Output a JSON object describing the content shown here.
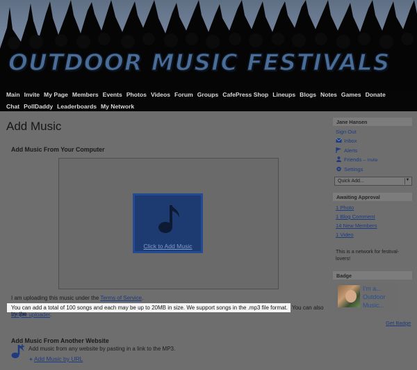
{
  "header": {
    "logo_text": "OUTDOOR MUSIC FESTIVALS",
    "nav_row1": [
      "Main",
      "Invite",
      "My Page",
      "Members",
      "Events",
      "Photos",
      "Videos",
      "Forum",
      "Groups",
      "CafePress Shop",
      "Lineups",
      "Blogs",
      "Notes",
      "Games",
      "Donate"
    ],
    "nav_row2": [
      "Chat",
      "PollDaddy",
      "Leaderboards",
      "My Network"
    ]
  },
  "main": {
    "page_title": "Add Music",
    "section1_title": "Add Music From Your Computer",
    "add_tile_label": "Click to Add Music",
    "terms_prefix": "I am uploading this music under the ",
    "terms_link": "Terms of Service",
    "terms_suffix": ".",
    "info_highlight": "You can add a total of 100 songs and each may be up to 20MB in size. We support songs in the .mp3 file format.",
    "info_rest": " You can also try the",
    "simple_uploader_link": "simple uploader",
    "info_end": ".",
    "section2_title": "Add Music From Another Website",
    "url_help": "Add music from any website by pasting in a link to the MP3.",
    "add_url_link": "Add Music by URL"
  },
  "sidebar": {
    "user_name": "Jane Hansen",
    "sign_out": "Sign Out",
    "inbox": "Inbox",
    "alerts": "Alerts",
    "friends": "Friends",
    "friends_sep": " – ",
    "invite": "Invite",
    "settings": "Settings",
    "quick_add": "Quick Add...",
    "awaiting_title": "Awaiting Approval",
    "awaiting": [
      "1 Photo",
      "1 Blog Comment",
      "14 New Members",
      "1 Video"
    ],
    "network_text": "This is a network for festival-lovers!",
    "badge_title": "Badge",
    "badge_line1": "I'm a...",
    "badge_line2": "Outdoor",
    "badge_line3": "Music...",
    "get_badge": "Get Badge"
  },
  "colors": {
    "accent_blue": "#1d3b80",
    "tile_blue": "#1d3b70",
    "overlay_gray": "#6e6e6e"
  }
}
